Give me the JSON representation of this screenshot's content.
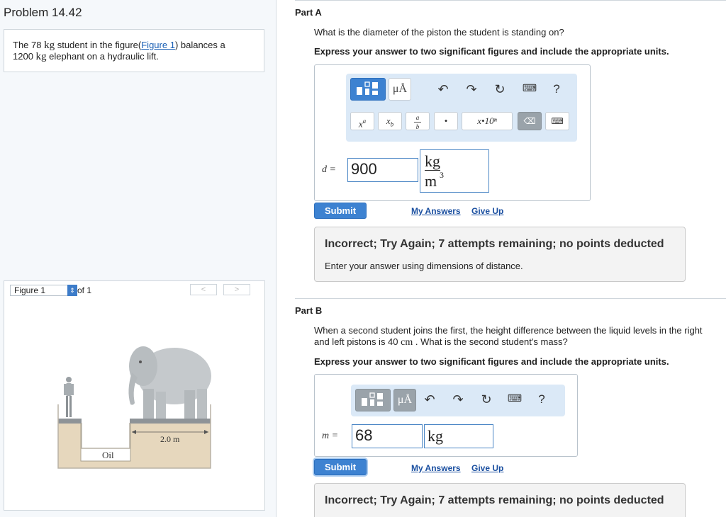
{
  "problem": {
    "title": "Problem 14.42",
    "text_pre": "The 78 ",
    "unit_kg": "kg",
    "text_mid": " student in the figure(",
    "figure_link": "Figure 1",
    "text_post": ") balances a",
    "text_line2_pre": "1200 ",
    "text_line2_post": " elephant on a hydraulic lift."
  },
  "figure_nav": {
    "select_value": "Figure 1",
    "of_label": "of 1",
    "prev": "<",
    "next": ">"
  },
  "figure": {
    "distance_label": "2.0 m",
    "fluid_label": "Oil"
  },
  "part_a": {
    "label": "Part A",
    "question": "What is the diameter of the piston the student is standing on?",
    "instruction": "Express your answer to two significant figures and include the appropriate units.",
    "var_label": "d =",
    "value": "900",
    "unit_num": "kg",
    "unit_den": "m",
    "unit_exp": "3",
    "submit": "Submit",
    "my_answers": "My Answers",
    "give_up": "Give Up",
    "feedback_title": "Incorrect; Try Again; 7 attempts remaining; no points deducted",
    "feedback_hint": "Enter your answer using dimensions of distance."
  },
  "part_b": {
    "label": "Part B",
    "question_1": "When a second student joins the first, the height difference between the liquid levels in the right",
    "question_2a": "and left pistons is 40 ",
    "question_unit": "cm",
    "question_2b": " . What is the second student's mass?",
    "instruction": "Express your answer to two significant figures and include the appropriate units.",
    "var_label": "m =",
    "value": "68",
    "unit": "kg",
    "submit": "Submit",
    "my_answers": "My Answers",
    "give_up": "Give Up",
    "feedback_title": "Incorrect; Try Again; 7 attempts remaining; no points deducted"
  },
  "toolbar": {
    "units_label": "μÅ",
    "help_label": "?",
    "superscript": "x",
    "superscript_a": "a",
    "subscript": "x",
    "subscript_b": "b",
    "frac_a": "a",
    "frac_b": "b",
    "dot": "•",
    "sci_notation": "x•10ⁿ"
  },
  "colors": {
    "accent": "#3d82d1",
    "link": "#1a4fa0",
    "toolbar_bg": "#dbe9f7"
  }
}
